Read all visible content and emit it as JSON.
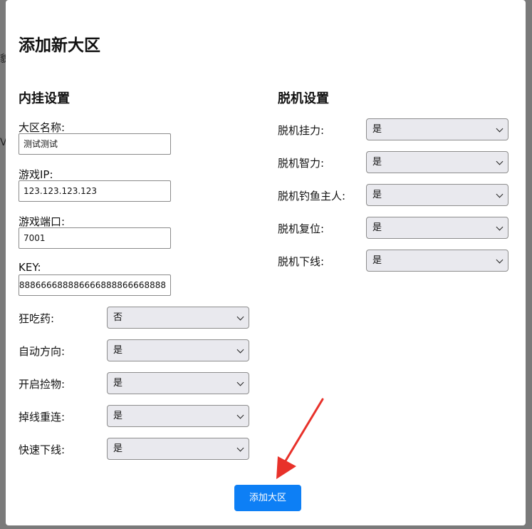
{
  "background": {
    "fragments": [
      "貌",
      "V"
    ]
  },
  "modal": {
    "title": "添加新大区",
    "submit_label": "添加大区"
  },
  "left_section": {
    "title": "内挂设置",
    "text_fields": [
      {
        "label": "大区名称:",
        "value": "测试测试"
      },
      {
        "label": "游戏IP:",
        "value": "123.123.123.123"
      },
      {
        "label": "游戏端口:",
        "value": "7001"
      },
      {
        "label": "KEY:",
        "value": "58888666688886666888866668888"
      }
    ],
    "selects": [
      {
        "label": "狂吃药:",
        "value": "否"
      },
      {
        "label": "自动方向:",
        "value": "是"
      },
      {
        "label": "开启捡物:",
        "value": "是"
      },
      {
        "label": "掉线重连:",
        "value": "是"
      },
      {
        "label": "快速下线:",
        "value": "是"
      }
    ]
  },
  "right_section": {
    "title": "脱机设置",
    "selects": [
      {
        "label": "脱机挂力:",
        "value": "是"
      },
      {
        "label": "脱机智力:",
        "value": "是"
      },
      {
        "label": "脱机钓鱼主人:",
        "value": "是"
      },
      {
        "label": "脱机复位:",
        "value": "是"
      },
      {
        "label": "脱机下线:",
        "value": "是"
      }
    ]
  },
  "colors": {
    "accent": "#0d7ff5",
    "annotation_arrow": "#e8312a"
  },
  "annotation": {
    "icon": "red-arrow-icon"
  }
}
